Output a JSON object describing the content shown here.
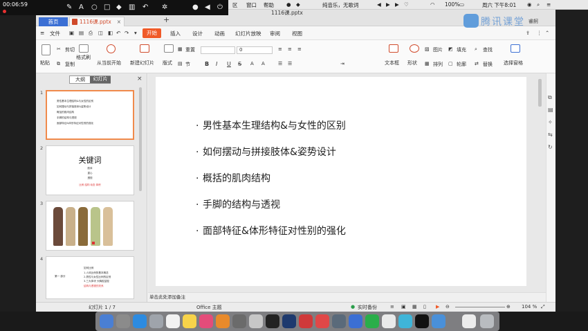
{
  "recorder": {
    "time": "00:06:59"
  },
  "menubar": {
    "items": [
      "区",
      "窗口",
      "帮助"
    ],
    "center_text": "纯音乐，无歌词",
    "battery": "100%",
    "clock": "周六 下午8:01"
  },
  "window": {
    "title": "1116课.pptx",
    "home_tab": "首页",
    "file_tab": "1116课.pptx",
    "brand": "腾讯课堂",
    "user": "睿舸"
  },
  "menu": {
    "file": "文件",
    "tabs": [
      "开始",
      "插入",
      "设计",
      "动画",
      "幻灯片放映",
      "审阅",
      "视图"
    ],
    "active": "开始"
  },
  "ribbon": {
    "paste": "粘贴",
    "cut": "剪切",
    "copy": "复制",
    "format_painter": "格式刷",
    "from_current": "从当前开始",
    "new_slide": "新建幻灯片",
    "layout": "版式",
    "section": "节",
    "reset": "重置",
    "font_size": "0",
    "bold": "B",
    "italic": "I",
    "underline": "U",
    "strike": "S",
    "textbox": "文本框",
    "shape": "形状",
    "picture": "图片",
    "fill": "填充",
    "find": "查找",
    "arrange": "排列",
    "outline": "轮廓",
    "replace": "替换",
    "select_pane": "选择窗格"
  },
  "panel": {
    "outline_tab": "大纲",
    "slides_tab": "幻灯片",
    "thumbs": [
      {
        "num": "1",
        "lines": [
          "男性基本生理结构&与女性的区别",
          "如何摆动与拼接肢体&姿势设计",
          "概括的肌肉结构",
          "手脚的结构与透视",
          "面部特征&体形特征对性别的强化"
        ]
      },
      {
        "num": "2",
        "title": "关键词",
        "lines": [
          "肢体",
          "重心",
          "透视"
        ],
        "red": "比例 结构 动态 体积"
      },
      {
        "num": "3"
      },
      {
        "num": "4",
        "left": "第一 部分",
        "lines": [
          "如何比例",
          "1.人体比例的基本概念",
          "2.男性与女性比例的区别",
          "3.三大体块 头胸腔盆腔"
        ],
        "red": "结构与透视的关系"
      }
    ]
  },
  "slide": {
    "bullets": [
      "男性基本生理结构&与女性的区别",
      "如何摆动与拼接肢体&姿势设计",
      "概括的肌肉结构",
      "手脚的结构与透视",
      "面部特征&体形特征对性别的强化"
    ]
  },
  "notes": {
    "placeholder": "单击此处添加备注"
  },
  "status": {
    "slide_counter": "幻灯片 1 / 7",
    "theme": "Office 主题",
    "backup": "实时备份",
    "zoom": "104 %"
  },
  "colors": {
    "accent": "#f05a28",
    "home_tab": "#3b6fd4",
    "selected_thumb": "#f08a4b"
  }
}
